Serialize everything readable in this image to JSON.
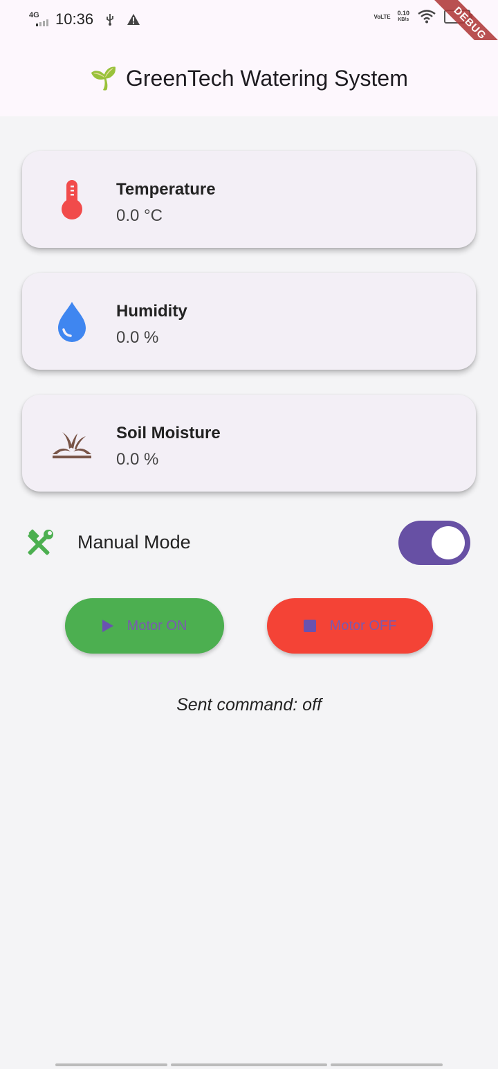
{
  "status_bar": {
    "network": "4G",
    "time": "10:36",
    "volte": "VoLTE",
    "speed": "0.10",
    "speed_unit": "KB/s"
  },
  "debug_banner": "DEBUG",
  "app_bar": {
    "emoji": "🌱",
    "title": "GreenTech Watering System"
  },
  "sensors": {
    "temperature": {
      "label": "Temperature",
      "value": "0.0 °C",
      "icon": "thermometer-icon",
      "color": "#f14b4b"
    },
    "humidity": {
      "label": "Humidity",
      "value": "0.0 %",
      "icon": "water-drop-icon",
      "color": "#3f86f0"
    },
    "soil": {
      "label": "Soil Moisture",
      "value": "0.0 %",
      "icon": "grass-icon",
      "color": "#795548"
    }
  },
  "manual_mode": {
    "label": "Manual Mode",
    "enabled": true,
    "icon": "hammer-wrench-icon",
    "icon_color": "#4caf50",
    "switch_color": "#6750a4"
  },
  "buttons": {
    "motor_on": {
      "label": "Motor ON",
      "color": "#4caf50"
    },
    "motor_off": {
      "label": "Motor OFF",
      "color": "#f44336"
    }
  },
  "sent_command": "Sent command: off"
}
